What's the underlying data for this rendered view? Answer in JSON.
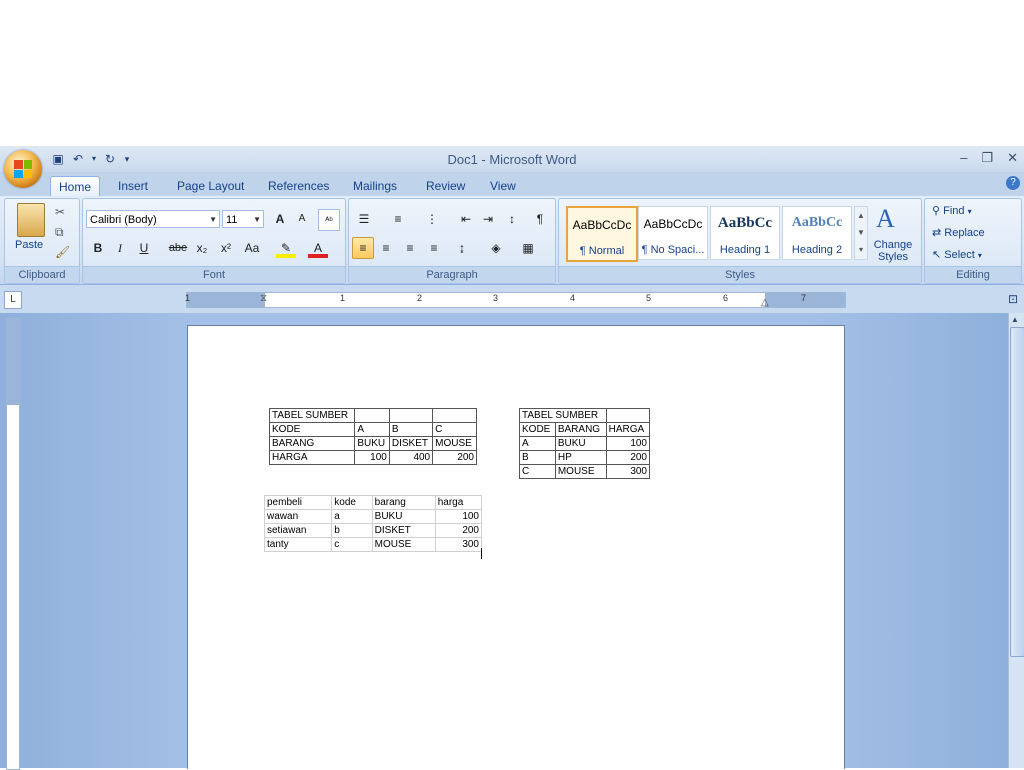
{
  "window": {
    "title": "Doc1 - Microsoft Word",
    "controls": {
      "minimize": "–",
      "restore": "❐",
      "close": "✕"
    }
  },
  "tabs": [
    "Home",
    "Insert",
    "Page Layout",
    "References",
    "Mailings",
    "Review",
    "View"
  ],
  "active_tab": "Home",
  "ribbon": {
    "clipboard": {
      "label": "Clipboard",
      "paste": "Paste"
    },
    "font": {
      "label": "Font",
      "font_name": "Calibri (Body)",
      "font_size": "11",
      "bold": "B",
      "italic": "I",
      "underline": "U",
      "strike": "abe",
      "subscript": "x₂",
      "superscript": "x²",
      "change_case": "Aa",
      "grow": "A",
      "shrink": "A",
      "font_color": "A"
    },
    "paragraph": {
      "label": "Paragraph"
    },
    "styles": {
      "label": "Styles",
      "items": [
        {
          "sample": "AaBbCcDc",
          "name": "¶ Normal"
        },
        {
          "sample": "AaBbCcDc",
          "name": "¶ No Spaci..."
        },
        {
          "sample": "AaBbCc",
          "name": "Heading 1"
        },
        {
          "sample": "AaBbCc",
          "name": "Heading 2"
        }
      ],
      "change_styles": "Change Styles"
    },
    "editing": {
      "label": "Editing",
      "find": "Find",
      "replace": "Replace",
      "select": "Select"
    }
  },
  "ruler": {
    "numbers": [
      "1",
      "1",
      "2",
      "3",
      "4",
      "5",
      "6",
      "7"
    ]
  },
  "document": {
    "table1": {
      "rows": [
        [
          "TABEL SUMBER",
          "",
          "",
          ""
        ],
        [
          "KODE",
          "A",
          "B",
          "C"
        ],
        [
          "BARANG",
          "BUKU",
          "DISKET",
          "MOUSE"
        ],
        [
          "HARGA",
          "100",
          "400",
          "200"
        ]
      ]
    },
    "table2": {
      "rows": [
        [
          "TABEL SUMBER",
          ""
        ],
        [
          "KODE",
          "BARANG",
          "HARGA"
        ],
        [
          "A",
          "BUKU",
          "100"
        ],
        [
          "B",
          "HP",
          "200"
        ],
        [
          "C",
          "MOUSE",
          "300"
        ]
      ]
    },
    "table3": {
      "rows": [
        [
          "pembeli",
          "kode",
          "barang",
          "harga"
        ],
        [
          "wawan",
          "a",
          "BUKU",
          "100"
        ],
        [
          "setiawan",
          "b",
          "DISKET",
          "200"
        ],
        [
          "tanty",
          "c",
          "MOUSE",
          "300"
        ]
      ]
    }
  },
  "colors": {
    "ribbon_bg": "#d5e3f4",
    "tab_text": "#15428b",
    "workspace": "#a4c0e6",
    "highlight": "#ffc95c"
  }
}
